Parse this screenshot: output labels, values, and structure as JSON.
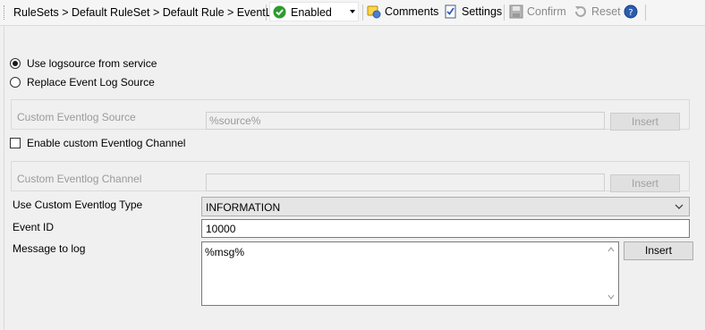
{
  "toolbar": {
    "breadcrumb": "RuleSets > Default RuleSet > Default Rule > EventLog",
    "status_value": "Enabled",
    "comments_label": "Comments",
    "settings_label": "Settings",
    "confirm_label": "Confirm",
    "reset_label": "Reset"
  },
  "source_options": [
    {
      "label": "Use logsource from service",
      "selected": true
    },
    {
      "label": "Replace Event Log Source",
      "selected": false
    }
  ],
  "custom_source": {
    "label": "Custom Eventlog Source",
    "value": "%source%",
    "insert_label": "Insert"
  },
  "custom_channel_toggle": {
    "label": "Enable custom Eventlog Channel",
    "checked": false
  },
  "custom_channel": {
    "label": "Custom Eventlog Channel",
    "value": "",
    "insert_label": "Insert"
  },
  "eventlog_type": {
    "label": "Use Custom Eventlog Type",
    "value": "INFORMATION"
  },
  "event_id": {
    "label": "Event ID",
    "value": "10000"
  },
  "message": {
    "label": "Message to log",
    "value": "%msg%",
    "insert_label": "Insert"
  },
  "colors": {
    "enabled_green": "#2e9b2e",
    "help_blue": "#2a5db0"
  }
}
